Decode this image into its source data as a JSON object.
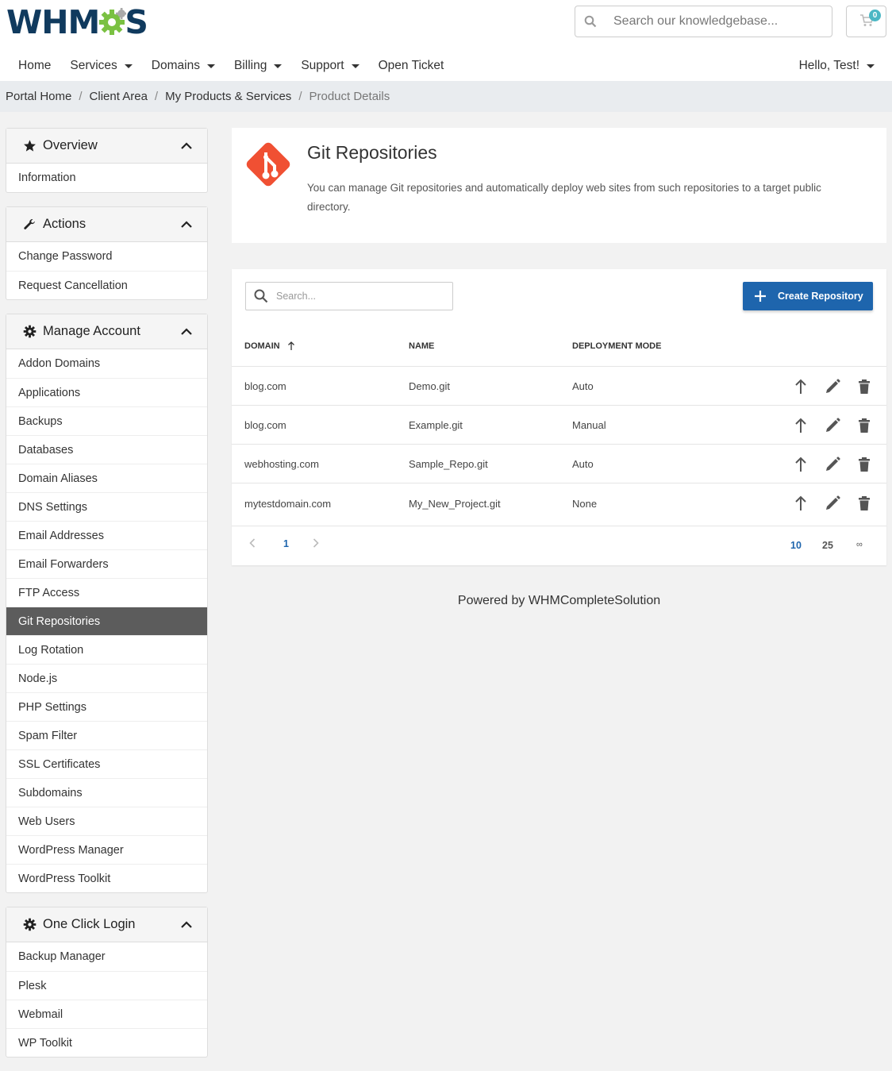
{
  "brand": {
    "logo_text_left": "WHM",
    "logo_text_right": "S",
    "logo_gear_color": "#7ac142"
  },
  "header": {
    "search_placeholder": "Search our knowledgebase...",
    "cart_count": "0",
    "nav": [
      {
        "label": "Home",
        "dropdown": false
      },
      {
        "label": "Services",
        "dropdown": true
      },
      {
        "label": "Domains",
        "dropdown": true
      },
      {
        "label": "Billing",
        "dropdown": true
      },
      {
        "label": "Support",
        "dropdown": true
      },
      {
        "label": "Open Ticket",
        "dropdown": false
      }
    ],
    "user_greeting": "Hello, Test!"
  },
  "breadcrumb": [
    "Portal Home",
    "Client Area",
    "My Products & Services",
    "Product Details"
  ],
  "sidebar": {
    "overview": {
      "title": "Overview",
      "icon": "star-icon",
      "items": [
        "Information"
      ]
    },
    "actions": {
      "title": "Actions",
      "icon": "wrench-icon",
      "items": [
        "Change Password",
        "Request Cancellation"
      ]
    },
    "manage": {
      "title": "Manage Account",
      "icon": "gear-icon",
      "active": "Git Repositories",
      "items": [
        "Addon Domains",
        "Applications",
        "Backups",
        "Databases",
        "Domain Aliases",
        "DNS Settings",
        "Email Addresses",
        "Email Forwarders",
        "FTP Access",
        "Git Repositories",
        "Log Rotation",
        "Node.js",
        "PHP Settings",
        "Spam Filter",
        "SSL Certificates",
        "Subdomains",
        "Web Users",
        "WordPress Manager",
        "WordPress Toolkit"
      ]
    },
    "oneclick": {
      "title": "One Click Login",
      "icon": "gear-icon",
      "items": [
        "Backup Manager",
        "Plesk",
        "Webmail",
        "WP Toolkit"
      ]
    }
  },
  "main": {
    "title": "Git Repositories",
    "description": "You can manage Git repositories and automatically deploy web sites from such repositories to a target public directory.",
    "git_color": "#f05033",
    "table_search_placeholder": "Search...",
    "create_button": "Create Repository",
    "accent_color": "#1e65ad",
    "columns": {
      "domain": "DOMAIN",
      "name": "NAME",
      "mode": "DEPLOYMENT MODE"
    },
    "rows": [
      {
        "domain": "blog.com",
        "name": "Demo.git",
        "mode": "Auto"
      },
      {
        "domain": "blog.com",
        "name": "Example.git",
        "mode": "Manual"
      },
      {
        "domain": "webhosting.com",
        "name": "Sample_Repo.git",
        "mode": "Auto"
      },
      {
        "domain": "mytestdomain.com",
        "name": "My_New_Project.git",
        "mode": "None"
      }
    ],
    "pager": {
      "current": "1",
      "sizes": [
        "10",
        "25",
        "∞"
      ],
      "active_size": "10"
    }
  },
  "footer": {
    "text": "Powered by WHMCompleteSolution"
  }
}
